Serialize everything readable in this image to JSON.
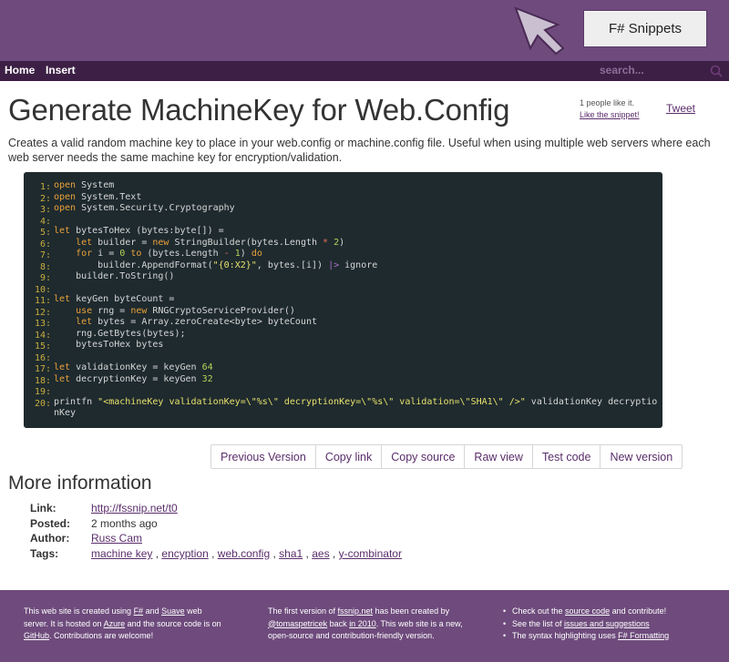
{
  "header": {
    "logo_label": "F# Snippets"
  },
  "nav": {
    "home": "Home",
    "insert": "Insert",
    "search_placeholder": "search..."
  },
  "snippet": {
    "title": "Generate MachineKey for Web.Config",
    "likes_text": "1 people like it.",
    "like_link": "Like the snippet!",
    "tweet": "Tweet",
    "description": "Creates a valid random machine key to place in your web.config or machine.config file. Useful when using multiple web servers where each web server needs the same machine key for encryption/validation."
  },
  "code": {
    "line_numbers": [
      "1:",
      "2:",
      "3:",
      "4:",
      "5:",
      "6:",
      "7:",
      "8:",
      "9:",
      "10:",
      "11:",
      "12:",
      "13:",
      "14:",
      "15:",
      "16:",
      "17:",
      "18:",
      "19:",
      "20:"
    ],
    "lines": [
      "open System",
      "open System.Text",
      "open System.Security.Cryptography",
      "",
      "let bytesToHex (bytes:byte[]) =",
      "    let builder = new StringBuilder(bytes.Length * 2)",
      "    for i = 0 to (bytes.Length - 1) do",
      "        builder.AppendFormat(\"{0:X2}\", bytes.[i]) |> ignore",
      "    builder.ToString()",
      "",
      "let keyGen byteCount =",
      "    use rng = new RNGCryptoServiceProvider()",
      "    let bytes = Array.zeroCreate<byte> byteCount",
      "    rng.GetBytes(bytes);",
      "    bytesToHex bytes",
      "",
      "let validationKey = keyGen 64",
      "let decryptionKey = keyGen 32",
      "",
      "printfn \"<machineKey validationKey=\\\"%s\\\" decryptionKey=\\\"%s\\\" validation=\\\"SHA1\\\" />\" validationKey decryptio",
      "nKey"
    ]
  },
  "actions": {
    "previous_version": "Previous Version",
    "copy_link": "Copy link",
    "copy_source": "Copy source",
    "raw_view": "Raw view",
    "test_code": "Test code",
    "new_version": "New version"
  },
  "more_info": {
    "heading": "More information",
    "link_label": "Link:",
    "link_value": "http://fssnip.net/t0",
    "posted_label": "Posted:",
    "posted_value": "2 months ago",
    "author_label": "Author:",
    "author_value": "Russ Cam",
    "tags_label": "Tags:",
    "tags": [
      "machine key",
      "encyption",
      "web.config",
      "sha1",
      "aes",
      "y-combinator"
    ]
  },
  "footer": {
    "col1": {
      "t1": "This web site is created using ",
      "fsharp": "F#",
      "t2": " and ",
      "suave": "Suave",
      "t3": " web server. It is hosted on ",
      "azure": "Azure",
      "t4": " and the source code is on ",
      "github": "GitHub",
      "t5": ". Contributions are welcome!"
    },
    "col2": {
      "t1": "The first version of ",
      "fssnip": "fssnip.net",
      "t2": " has been created by ",
      "author": "@tomaspetricek",
      "t3": " back ",
      "year": "in 2010",
      "t4": ". This web site is a new, open-source and contribution-friendly version."
    },
    "col3": {
      "b1_t1": "Check out the ",
      "b1_link": "source code",
      "b1_t2": " and contribute!",
      "b2_t1": "See the list of ",
      "b2_link": "issues and suggestions",
      "b3_t1": "The syntax highlighting uses ",
      "b3_link": "F# Formatting"
    }
  },
  "colors": {
    "header_bg": "#6e4b7c",
    "nav_bg": "#3d1f45",
    "code_bg": "#1e2a2e",
    "link": "#5a2d6a"
  },
  "icons": {
    "logo": "cursor-arrow-icon",
    "search": "search-icon"
  }
}
